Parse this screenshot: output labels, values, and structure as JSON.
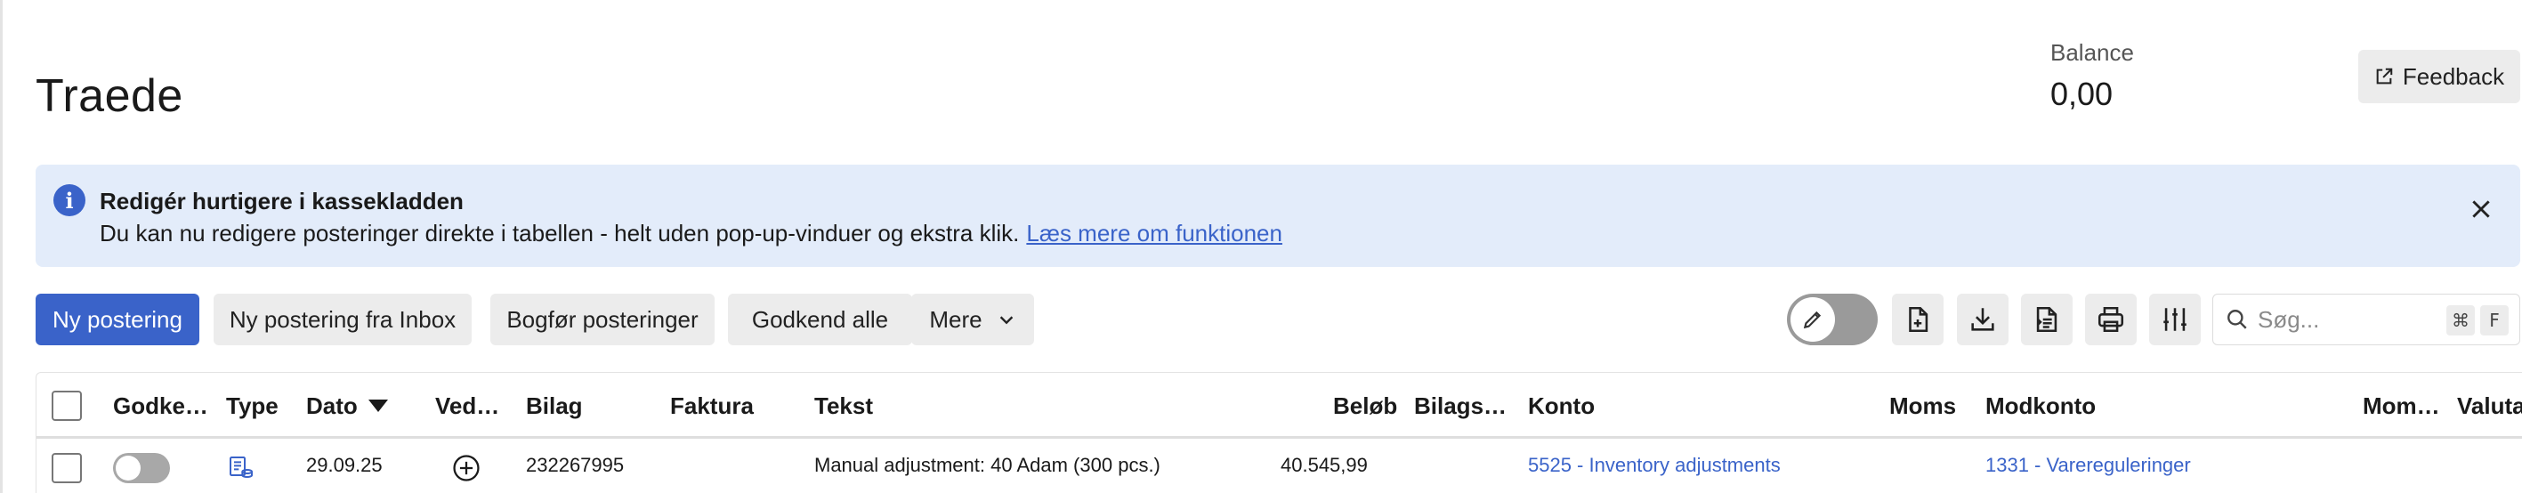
{
  "page": {
    "title": "Traede"
  },
  "balance": {
    "label": "Balance",
    "value": "0,00"
  },
  "feedback": {
    "label": "Feedback"
  },
  "banner": {
    "title": "Redigér hurtigere i kassekladden",
    "text": "Du kan nu redigere posteringer direkte i tabellen - helt uden pop-up-vinduer og ekstra klik.",
    "link": "Læs mere om funktionen"
  },
  "toolbar": {
    "new_label": "Ny postering",
    "new_inbox_label": "Ny postering fra Inbox",
    "book_label": "Bogfør posteringer",
    "approve_all_label": "Godkend alle",
    "more_label": "Mere"
  },
  "search": {
    "placeholder": "Søg...",
    "shortcut_cmd": "⌘",
    "shortcut_key": "F"
  },
  "table": {
    "columns": [
      "Godke…",
      "Type",
      "Dato",
      "Ved…",
      "Bilag",
      "Faktura",
      "Tekst",
      "Beløb",
      "Bilags…",
      "Konto",
      "Moms",
      "Modkonto",
      "Mom…",
      "Valuta"
    ],
    "rows": [
      {
        "dato": "29.09.25",
        "bilag": "232267995",
        "faktura": "",
        "tekst": "Manual adjustment: 40 Adam (300 pcs.)",
        "belob": "40.545,99",
        "konto": "5525 - Inventory adjustments",
        "modkonto": "1331 - Varereguleringer"
      }
    ]
  },
  "colors": {
    "accent": "#3a63c9",
    "banner_bg": "#e3ecfa",
    "button_bg": "#ececec"
  }
}
